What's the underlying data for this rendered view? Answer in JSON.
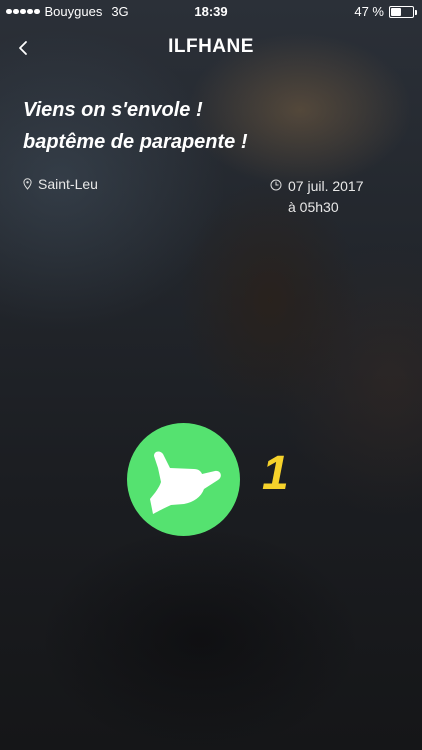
{
  "status_bar": {
    "carrier": "Bouygues",
    "network": "3G",
    "time": "18:39",
    "battery_percent": "47 %"
  },
  "nav": {
    "title": "ILFHANE",
    "back_icon": "chevron-left-icon"
  },
  "event": {
    "title_line1": "Viens on s'envole !",
    "title_line2": "baptême de parapente !",
    "location": "Saint-Leu",
    "date": "07 juil. 2017",
    "time": "à 05h30",
    "location_icon": "map-pin-icon",
    "clock_icon": "clock-icon"
  },
  "reaction": {
    "icon": "shaka-hand-icon",
    "count": "1",
    "button_color": "#55e270",
    "count_color": "#f6d22b"
  }
}
